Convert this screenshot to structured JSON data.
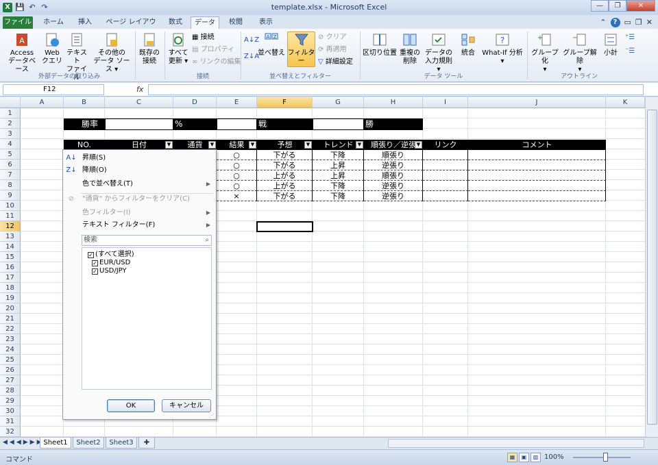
{
  "window": {
    "title": "template.xlsx - Microsoft Excel"
  },
  "qat": {
    "logo": "X",
    "save": "💾",
    "undo": "↶",
    "redo": "↷"
  },
  "tabs": [
    "ファイル",
    "ホーム",
    "挿入",
    "ページ レイアウト",
    "数式",
    "データ",
    "校閲",
    "表示"
  ],
  "ribbon": {
    "access": [
      "Access",
      "データベース"
    ],
    "web": [
      "Web",
      "クエリ"
    ],
    "text": [
      "テキスト",
      "ファイル"
    ],
    "other": [
      "その他の",
      "データ ソース ▾"
    ],
    "existing": [
      "既存の",
      "接続"
    ],
    "refresh": [
      "すべて",
      "更新 ▾"
    ],
    "connections": "接続",
    "properties": "プロパティ",
    "editlinks": "リンクの編集",
    "sort_label": "並べ替え",
    "filter_label": "フィルター",
    "clear": "クリア",
    "reapply": "再適用",
    "advanced": "詳細設定",
    "split": "区切り位置",
    "dup": [
      "重複の",
      "削除"
    ],
    "validation": [
      "データの",
      "入力規則 ▾"
    ],
    "consolidate": "統合",
    "whatif": [
      "What-If 分析",
      "▾"
    ],
    "group": [
      "グループ化",
      "▾"
    ],
    "ungroup": [
      "グループ解除",
      "▾"
    ],
    "subtotal": "小計",
    "groups": [
      "外部データの取り込み",
      "接続",
      "並べ替えとフィルター",
      "データ ツール",
      "アウトライン"
    ]
  },
  "formula_bar": {
    "namebox": "F12",
    "fx": "fx",
    "value": ""
  },
  "columns": [
    "A",
    "B",
    "C",
    "D",
    "E",
    "F",
    "G",
    "H",
    "I",
    "J",
    "K"
  ],
  "rows": [
    "1",
    "2",
    "3",
    "4",
    "5",
    "6",
    "7",
    "8",
    "9",
    "10",
    "11",
    "12",
    "13",
    "14",
    "15",
    "16",
    "17",
    "18",
    "19",
    "20",
    "21",
    "22",
    "23",
    "24",
    "25",
    "26",
    "27",
    "28",
    "29",
    "30",
    "31",
    "32"
  ],
  "sheet": {
    "win_rate_label": "勝率",
    "percent": "%",
    "battles": "戦",
    "wins": "勝",
    "headers": [
      "NO.",
      "日付",
      "通貨",
      "結果",
      "予想",
      "トレンド",
      "順張り／逆張",
      "リンク",
      "コメント"
    ],
    "data": [
      {
        "result": "○",
        "forecast": "下がる",
        "trend": "下降",
        "style": "順張り"
      },
      {
        "result": "○",
        "forecast": "下がる",
        "trend": "上昇",
        "style": "逆張り"
      },
      {
        "result": "○",
        "forecast": "上がる",
        "trend": "上昇",
        "style": "順張り"
      },
      {
        "result": "○",
        "forecast": "上がる",
        "trend": "下降",
        "style": "逆張り"
      },
      {
        "result": "×",
        "forecast": "下がる",
        "trend": "下降",
        "style": "逆張り"
      }
    ]
  },
  "filter_menu": {
    "sort_asc": "昇順(S)",
    "sort_desc": "降順(O)",
    "sort_color": "色で並べ替え(T)",
    "clear_filter": "\"通貨\" からフィルターをクリア(C)",
    "color_filter": "色フィルター(I)",
    "text_filter": "テキスト フィルター(F)",
    "search_placeholder": "検索",
    "items": [
      "(すべて選択)",
      "EUR/USD",
      "USD/JPY"
    ],
    "ok": "OK",
    "cancel": "キャンセル"
  },
  "sheet_tabs": [
    "Sheet1",
    "Sheet2",
    "Sheet3"
  ],
  "status": {
    "mode": "コマンド",
    "zoom": "100%"
  }
}
